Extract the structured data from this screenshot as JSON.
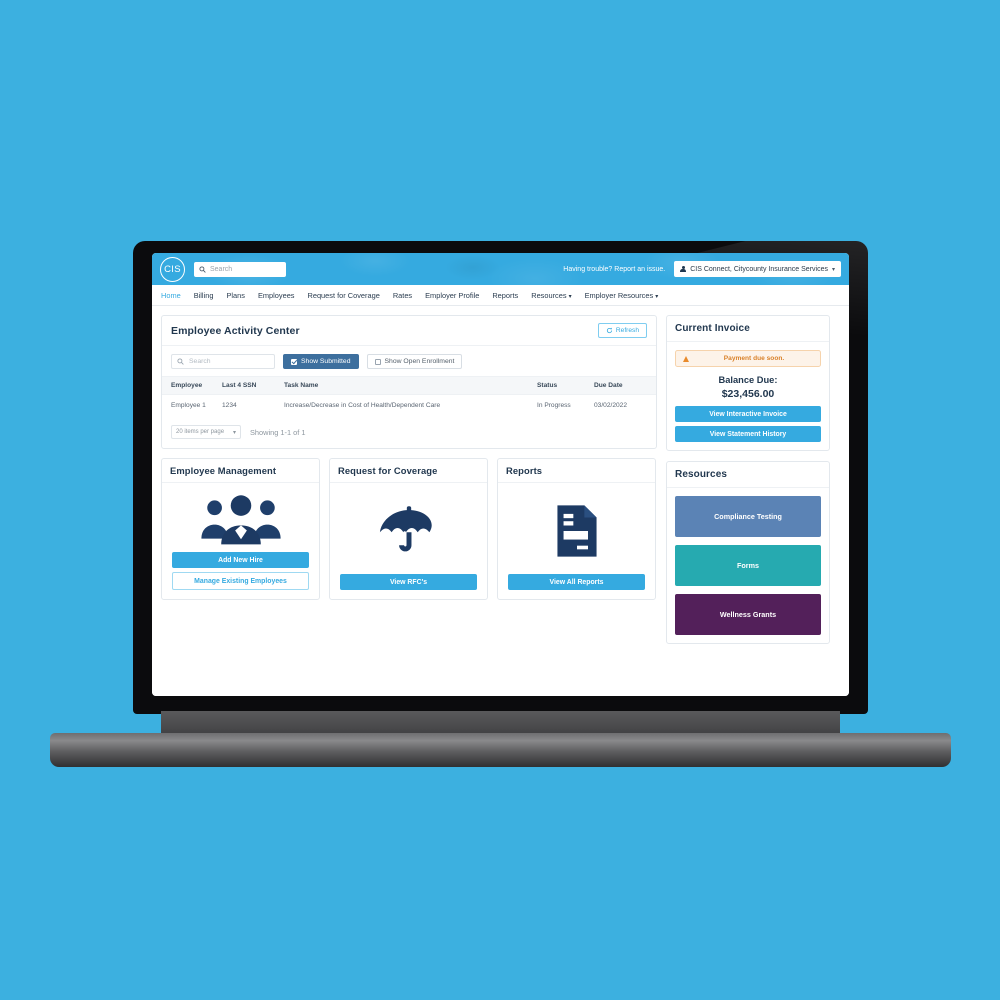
{
  "app": {
    "logo_text": "CIS",
    "search_placeholder": "Search",
    "trouble_text": "Having trouble? Report an issue.",
    "account_name": "CIS Connect, Citycounty Insurance Services",
    "caret": "▾"
  },
  "nav": {
    "items": [
      {
        "label": "Home",
        "active": true,
        "dropdown": false
      },
      {
        "label": "Billing",
        "active": false,
        "dropdown": false
      },
      {
        "label": "Plans",
        "active": false,
        "dropdown": false
      },
      {
        "label": "Employees",
        "active": false,
        "dropdown": false
      },
      {
        "label": "Request for Coverage",
        "active": false,
        "dropdown": false
      },
      {
        "label": "Rates",
        "active": false,
        "dropdown": false
      },
      {
        "label": "Employer Profile",
        "active": false,
        "dropdown": false
      },
      {
        "label": "Reports",
        "active": false,
        "dropdown": false
      },
      {
        "label": "Resources",
        "active": false,
        "dropdown": true
      },
      {
        "label": "Employer Resources",
        "active": false,
        "dropdown": true
      }
    ]
  },
  "activity_center": {
    "title": "Employee Activity Center",
    "refresh_label": "Refresh",
    "refresh_icon": "refresh-icon",
    "search_placeholder": "Search",
    "filter_submitted": "Show Submitted",
    "filter_submitted_checked": true,
    "filter_open_enrollment": "Show Open Enrollment",
    "filter_open_enrollment_checked": false,
    "columns": [
      "Employee",
      "Last 4 SSN",
      "Task Name",
      "Status",
      "Due Date"
    ],
    "rows": [
      {
        "employee": "Employee 1",
        "ssn": "1234",
        "task": "Increase/Decrease in Cost of Health/Dependent Care",
        "status": "In Progress",
        "due": "03/02/2022"
      }
    ],
    "per_page": "20 items per page",
    "showing": "Showing 1-1 of 1"
  },
  "cards": [
    {
      "title": "Employee Management",
      "icon": "people-group-icon",
      "buttons": [
        {
          "label": "Add New Hire",
          "style": "primary"
        },
        {
          "label": "Manage Existing Employees",
          "style": "outline"
        }
      ]
    },
    {
      "title": "Request for Coverage",
      "icon": "umbrella-icon",
      "buttons": [
        {
          "label": "View RFC's",
          "style": "primary"
        }
      ]
    },
    {
      "title": "Reports",
      "icon": "document-report-icon",
      "buttons": [
        {
          "label": "View All Reports",
          "style": "primary"
        }
      ]
    }
  ],
  "invoice": {
    "title": "Current Invoice",
    "alert_icon": "warning-triangle-icon",
    "alert_text": "Payment due soon.",
    "balance_label": "Balance Due:",
    "balance_amount": "$23,456.00",
    "buttons": [
      {
        "label": "View Interactive Invoice"
      },
      {
        "label": "View Statement History"
      }
    ]
  },
  "resources": {
    "title": "Resources",
    "items": [
      {
        "label": "Compliance Testing",
        "color": "#5b83b5"
      },
      {
        "label": "Forms",
        "color": "#26aab0"
      },
      {
        "label": "Wellness Grants",
        "color": "#53205a"
      }
    ]
  },
  "colors": {
    "page_background": "#3cb0e0",
    "brand_blue": "#35aae0",
    "navy": "#22384f",
    "chip_active": "#3d6f9e",
    "alert_orange": "#d9822b"
  }
}
